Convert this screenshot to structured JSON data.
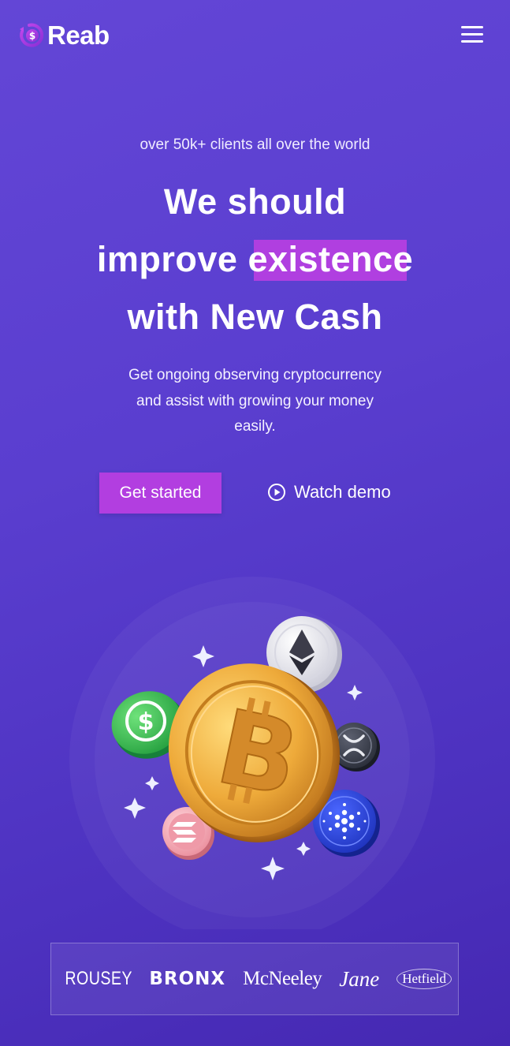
{
  "header": {
    "brand": "Reab",
    "logo_icon": "dollar-coin-swirl-icon",
    "menu_icon": "hamburger-menu-icon"
  },
  "hero": {
    "eyebrow": "over 50k+ clients all over the world",
    "headline_line1": "We should",
    "headline_line2_prefix": "improve ",
    "headline_highlight": "existence",
    "headline_line3": "with New Cash",
    "subtitle_line1": "Get ongoing observing cryptocurrency",
    "subtitle_line2": "and assist with growing your money",
    "subtitle_line3": "easily.",
    "cta_primary": "Get started",
    "cta_secondary": "Watch demo",
    "cta_secondary_icon": "play-circle-icon"
  },
  "illustration": {
    "coins": [
      "bitcoin-coin-icon",
      "ethereum-coin-icon",
      "usd-coin-icon",
      "xrp-coin-icon",
      "cardano-coin-icon",
      "solana-coin-icon"
    ],
    "decor": "sparkle-icon"
  },
  "brands": [
    "ROUSEY",
    "BRONX",
    "McNeeley",
    "Jane",
    "Hetfield"
  ],
  "colors": {
    "background": "#5a3ecf",
    "accent": "#b23ee0",
    "text": "#ffffff"
  }
}
